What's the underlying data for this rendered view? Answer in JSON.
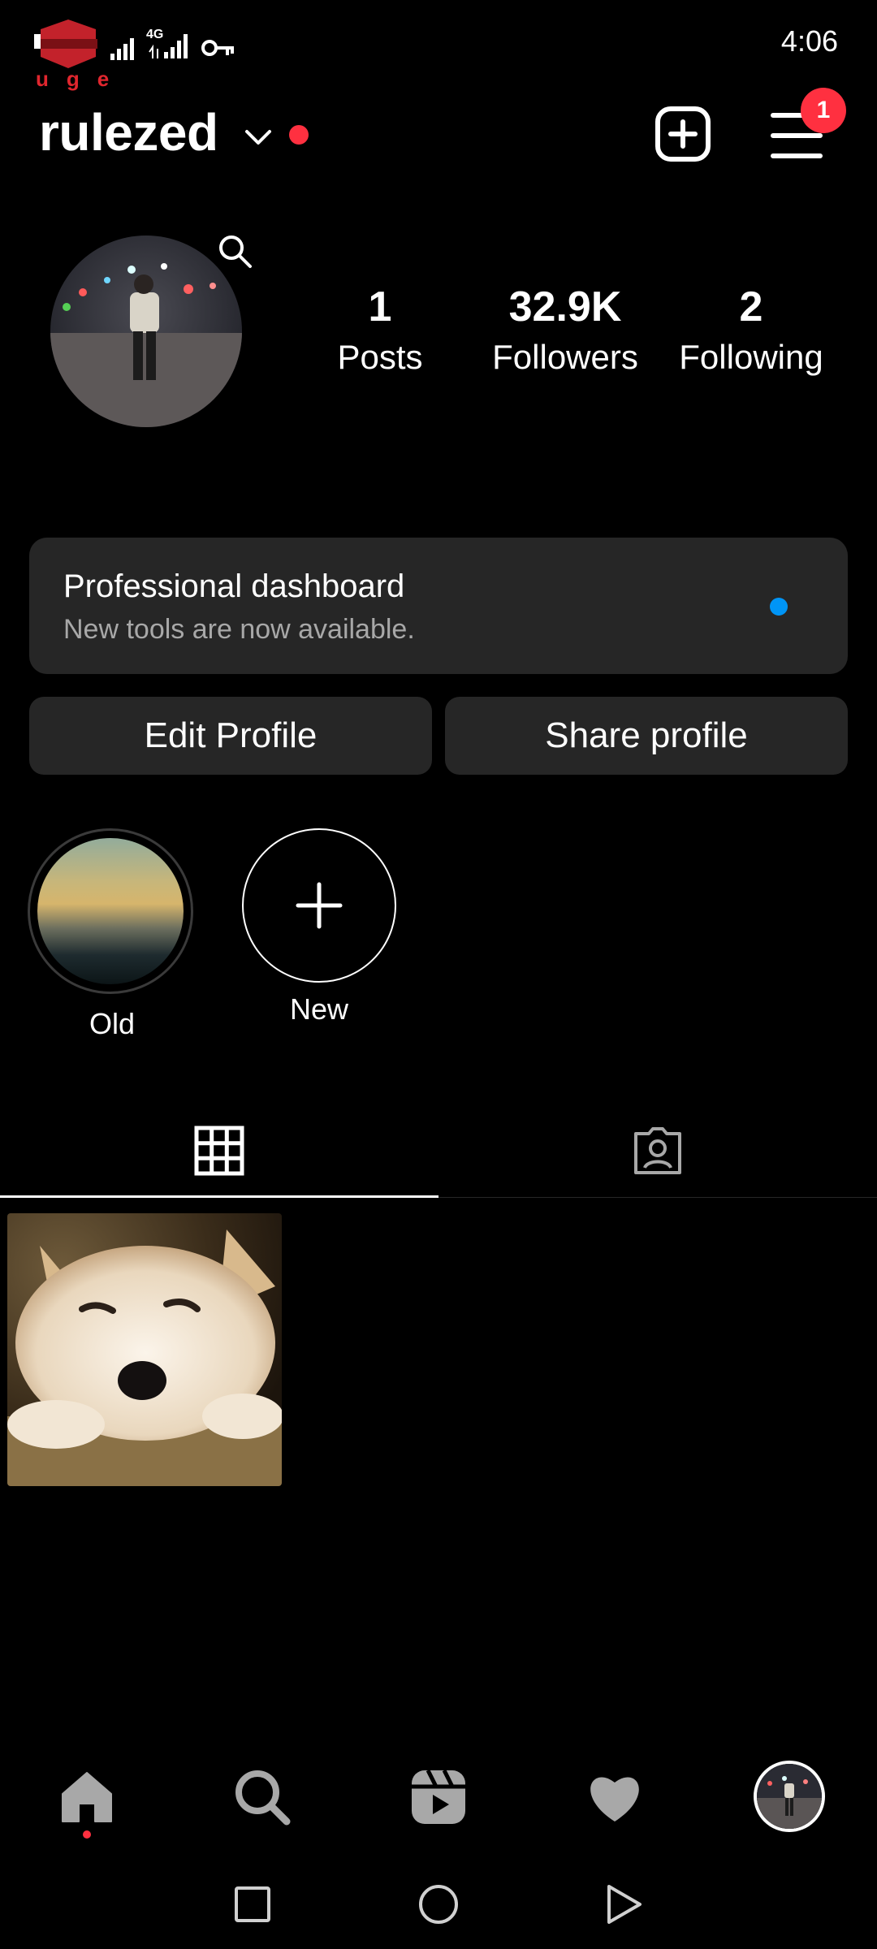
{
  "status_bar": {
    "time": "4:06",
    "network_label": "4G",
    "logo_text": "uge"
  },
  "header": {
    "username": "rulezed",
    "menu_badge": "1"
  },
  "stats": [
    {
      "value": "1",
      "label": "Posts"
    },
    {
      "value": "32.9K",
      "label": "Followers"
    },
    {
      "value": "2",
      "label": "Following"
    }
  ],
  "dashboard": {
    "title": "Professional dashboard",
    "subtitle": "New tools are now available."
  },
  "buttons": {
    "edit": "Edit Profile",
    "share": "Share profile"
  },
  "highlights": [
    {
      "label": "Old"
    },
    {
      "label": "New"
    }
  ],
  "colors": {
    "accent_red": "#ff3040",
    "accent_blue": "#0095f6",
    "card_bg": "#262626"
  },
  "icons": {
    "create": "plus-square-icon",
    "menu": "hamburger-icon",
    "grid": "grid-icon",
    "tagged": "tagged-person-icon"
  }
}
